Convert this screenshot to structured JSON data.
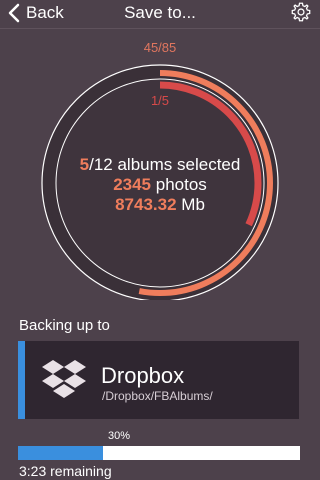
{
  "nav": {
    "back_label": "Back",
    "title": "Save to..."
  },
  "selection": {
    "outer_count": "45/85",
    "outer_fraction": 0.53,
    "inner_count": "1/5",
    "inner_fraction": 0.32,
    "albums_selected": "5",
    "albums_total_text": "/12 albums selected",
    "photos_count": "2345",
    "photos_label": "photos",
    "size_value": "8743.32",
    "size_unit": "Mb"
  },
  "destination": {
    "section_label": "Backing up to",
    "name": "Dropbox",
    "path": "/Dropbox/FBAlbums/",
    "icon": "dropbox-icon"
  },
  "progress": {
    "label": "30%",
    "value": 0.3,
    "remaining": "3:23 remaining"
  },
  "colors": {
    "background": "#4d414b",
    "accent_orange": "#ef7d5c",
    "accent_red": "#d74a4a",
    "accent_blue": "#3a8fde",
    "card": "#2f2630"
  }
}
